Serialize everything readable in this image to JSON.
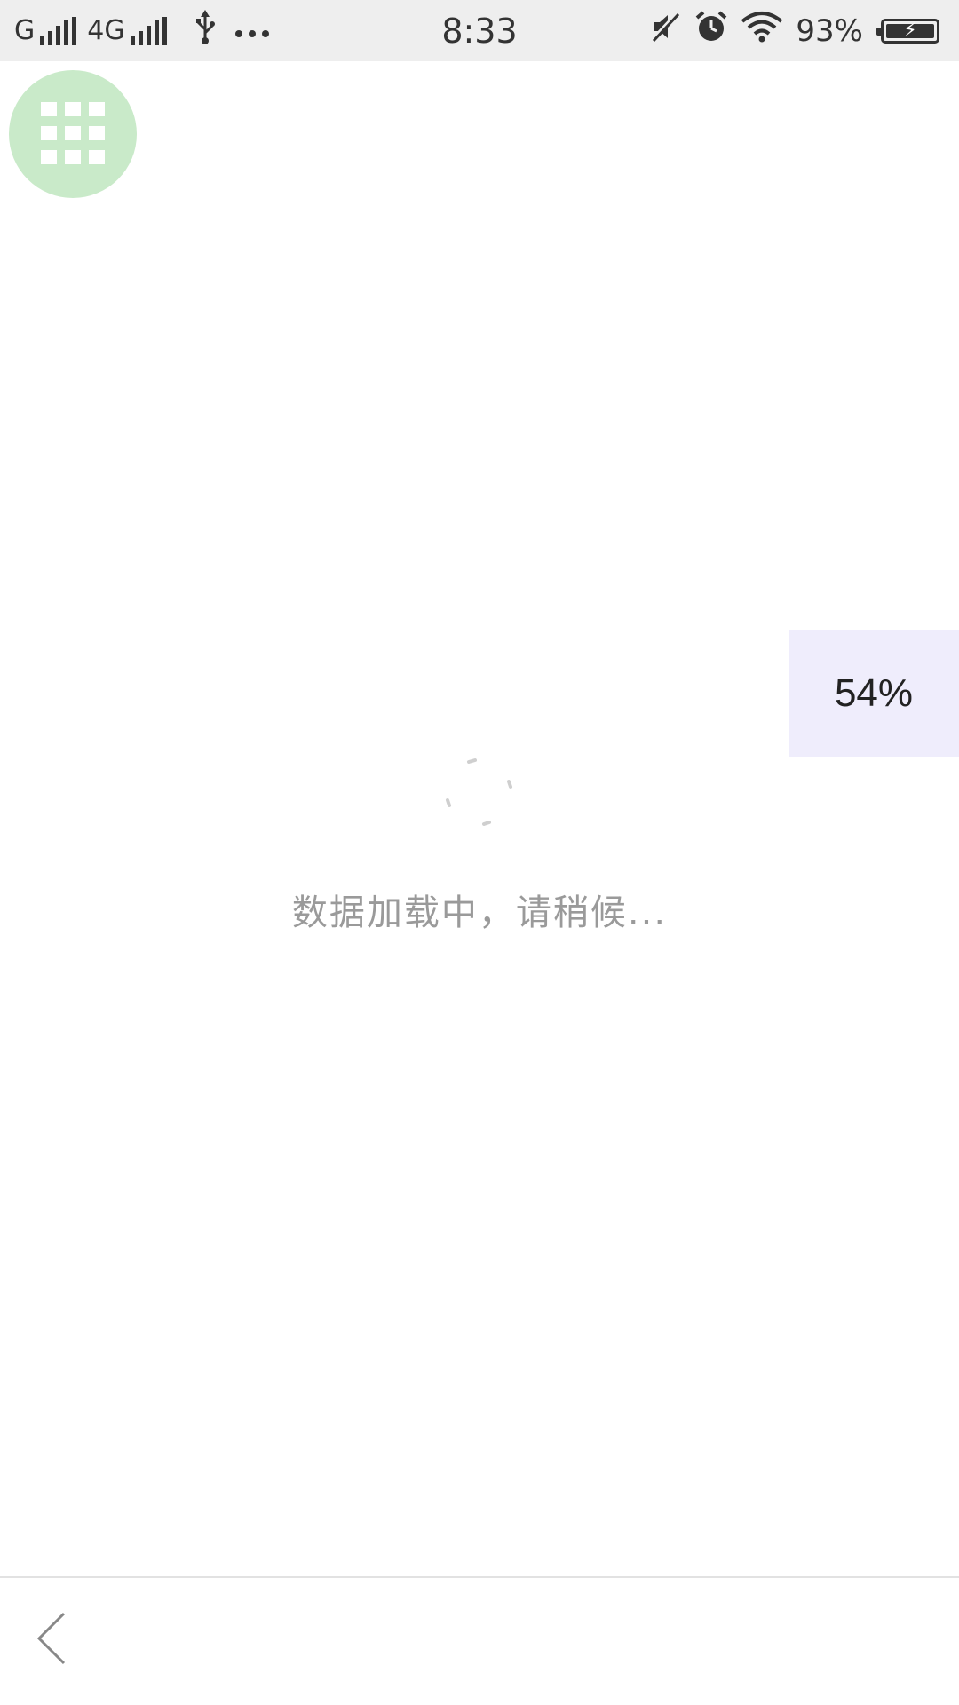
{
  "status_bar": {
    "carrier1": "G",
    "carrier2": "4G",
    "time": "8:33",
    "battery_percent": "93%",
    "icons": [
      "signal-icon",
      "usb-icon",
      "more-dots-icon",
      "mute-icon",
      "alarm-icon",
      "wifi-icon",
      "battery-charging-icon"
    ]
  },
  "fab": {
    "icon": "apps-grid-icon",
    "color": "#c9eac9"
  },
  "progress": {
    "label": "54%",
    "value": 0.54,
    "background": "#efedfc"
  },
  "loading": {
    "text": "数据加载中，请稍候..."
  },
  "bottom_bar": {
    "back_icon": "chevron-left-icon"
  }
}
